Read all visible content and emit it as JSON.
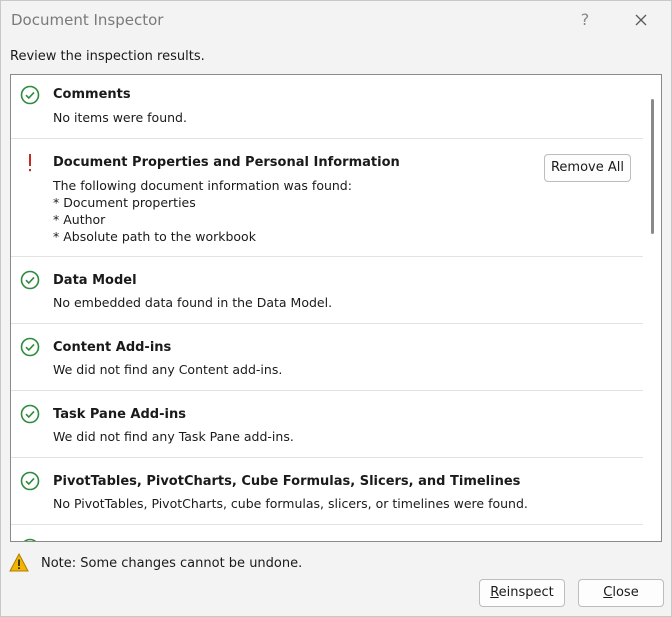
{
  "window": {
    "title": "Document Inspector",
    "help_label": "?"
  },
  "subtitle": "Review the inspection results.",
  "items": [
    {
      "status": "ok",
      "name": "Comments",
      "description": "No items were found."
    },
    {
      "status": "warning",
      "name": "Document Properties and Personal Information",
      "description": "The following document information was found:\n* Document properties\n* Author\n* Absolute path to the workbook",
      "action_label": "Remove All"
    },
    {
      "status": "ok",
      "name": "Data Model",
      "description": "No embedded data found in the Data Model."
    },
    {
      "status": "ok",
      "name": "Content Add-ins",
      "description": "We did not find any Content add-ins."
    },
    {
      "status": "ok",
      "name": "Task Pane Add-ins",
      "description": "We did not find any Task Pane add-ins."
    },
    {
      "status": "ok",
      "name": "PivotTables, PivotCharts, Cube Formulas, Slicers, and Timelines",
      "description": "No PivotTables, PivotCharts, cube formulas, slicers, or timelines were found."
    }
  ],
  "footer": {
    "note": "Note: Some changes cannot be undone.",
    "reinspect": {
      "mnemonic": "R",
      "rest": "einspect"
    },
    "close": {
      "mnemonic": "C",
      "rest": "lose"
    }
  },
  "colors": {
    "ok_green": "#2e8b3d",
    "warning_red": "#c42b1c",
    "alert_yellow": "#f2b600"
  },
  "icons": {
    "ok": "check-circle-icon",
    "warning": "exclamation-icon",
    "note": "warning-triangle-icon"
  }
}
